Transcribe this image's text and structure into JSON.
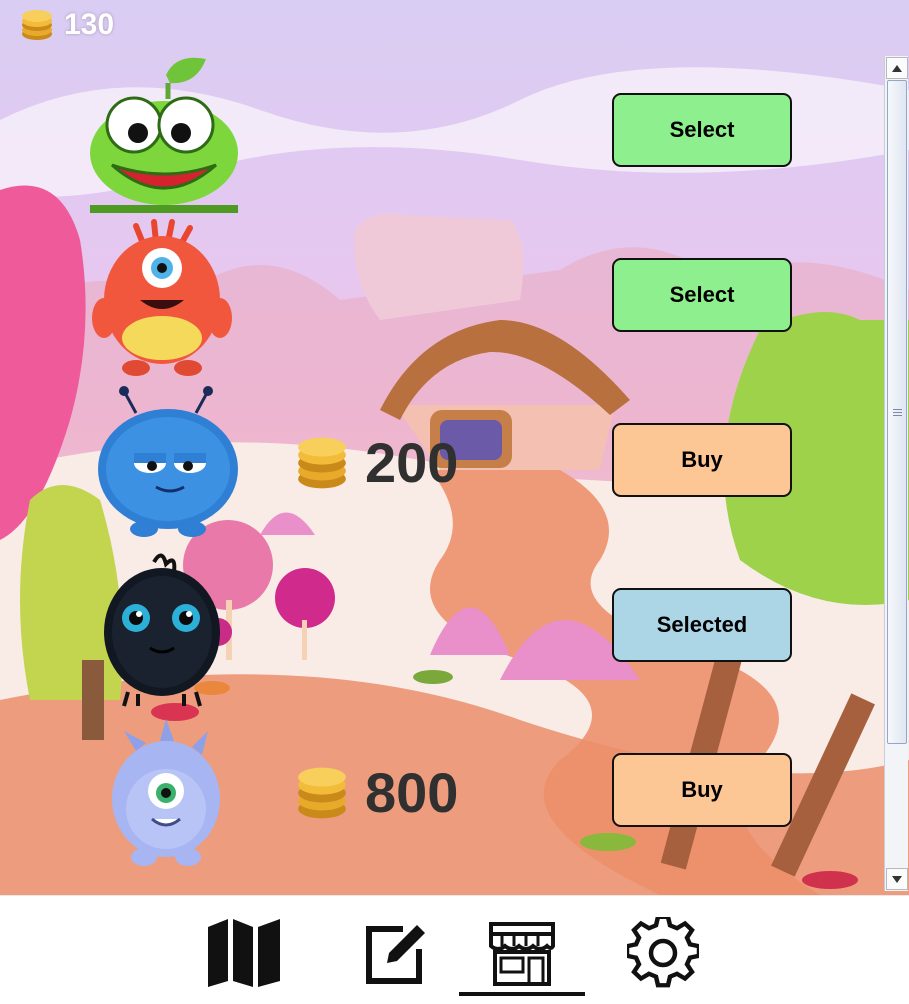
{
  "header": {
    "coins": "130"
  },
  "shop": {
    "characters": [
      {
        "avatar": "green-frog-sprout",
        "price": "",
        "action": "Select",
        "state": "owned"
      },
      {
        "avatar": "red-one-eyed-monster",
        "price": "",
        "action": "Select",
        "state": "owned"
      },
      {
        "avatar": "blue-fuzzy-monster",
        "price": "200",
        "action": "Buy",
        "state": "locked"
      },
      {
        "avatar": "black-fuzzy-monster",
        "price": "",
        "action": "Selected",
        "state": "selected"
      },
      {
        "avatar": "lavender-one-eyed-monster",
        "price": "800",
        "action": "Buy",
        "state": "locked"
      }
    ]
  },
  "nav": {
    "items": [
      {
        "icon": "map-icon"
      },
      {
        "icon": "edit-icon"
      },
      {
        "icon": "store-icon",
        "active": true
      },
      {
        "icon": "gear-icon"
      }
    ]
  },
  "colors": {
    "select": "#8def8d",
    "buy": "#fcc794",
    "selected": "#acd6e6",
    "price_text": "#303030"
  }
}
